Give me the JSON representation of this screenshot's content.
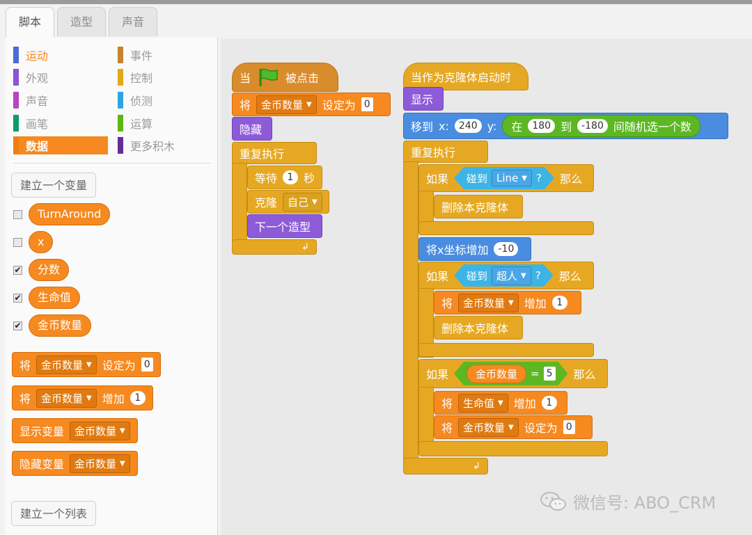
{
  "tabs": [
    {
      "label": "脚本"
    },
    {
      "label": "造型"
    },
    {
      "label": "声音"
    }
  ],
  "categories": [
    {
      "label": "运动",
      "color": "#4a6cd4"
    },
    {
      "label": "外观",
      "color": "#8a55d7"
    },
    {
      "label": "声音",
      "color": "#bb42c3"
    },
    {
      "label": "画笔",
      "color": "#0e9a6c"
    },
    {
      "label": "数据",
      "color": "#ee7d16"
    },
    {
      "label": "事件",
      "color": "#c88330"
    },
    {
      "label": "控制",
      "color": "#e1a91a"
    },
    {
      "label": "侦测",
      "color": "#2ca5e2"
    },
    {
      "label": "运算",
      "color": "#5cb712"
    },
    {
      "label": "更多积木",
      "color": "#632d99"
    }
  ],
  "palette": {
    "make_variable": "建立一个变量",
    "make_list": "建立一个列表",
    "variables": [
      {
        "name": "TurnAround",
        "checked": ""
      },
      {
        "name": "x",
        "checked": ""
      },
      {
        "name": "分数",
        "checked": "✔"
      },
      {
        "name": "生命值",
        "checked": "✔"
      },
      {
        "name": "金币数量",
        "checked": "✔"
      }
    ],
    "blocks": {
      "set_label": "将",
      "set_var": "金币数量",
      "set_to": "设定为",
      "set_val": "0",
      "change_label": "将",
      "change_var": "金币数量",
      "change_by": "增加",
      "change_val": "1",
      "show_label": "显示变量",
      "show_var": "金币数量",
      "hide_label": "隐藏变量",
      "hide_var": "金币数量"
    }
  },
  "script1": {
    "when": "当",
    "clicked": "被点击",
    "set_label": "将",
    "set_var": "金币数量",
    "set_to": "设定为",
    "set_val": "0",
    "hide": "隐藏",
    "forever": "重复执行",
    "wait": "等待",
    "wait_val": "1",
    "sec": "秒",
    "clone": "克隆",
    "clone_target": "自己",
    "next_costume": "下一个造型"
  },
  "script2": {
    "hat": "当作为克隆体启动时",
    "show": "显示",
    "goto": "移到",
    "x_label": "x:",
    "x_val": "240",
    "y_label": "y:",
    "rand_in": "在",
    "rand_from": "180",
    "rand_to_word": "到",
    "rand_to": "-180",
    "rand_end": "间随机选一个数",
    "forever": "重复执行",
    "if": "如果",
    "then": "那么",
    "touching": "碰到",
    "q": "?",
    "touch1": "Line",
    "delete": "删除本克隆体",
    "change_x": "将x坐标增加",
    "change_x_val": "-10",
    "touch2": "超人",
    "change_label": "将",
    "coin_var": "金币数量",
    "change_by": "增加",
    "one": "1",
    "eq": "=",
    "five": "5",
    "life_var": "生命值",
    "set_to": "设定为",
    "zero": "0"
  },
  "watermark": "微信号: ABO_CRM"
}
